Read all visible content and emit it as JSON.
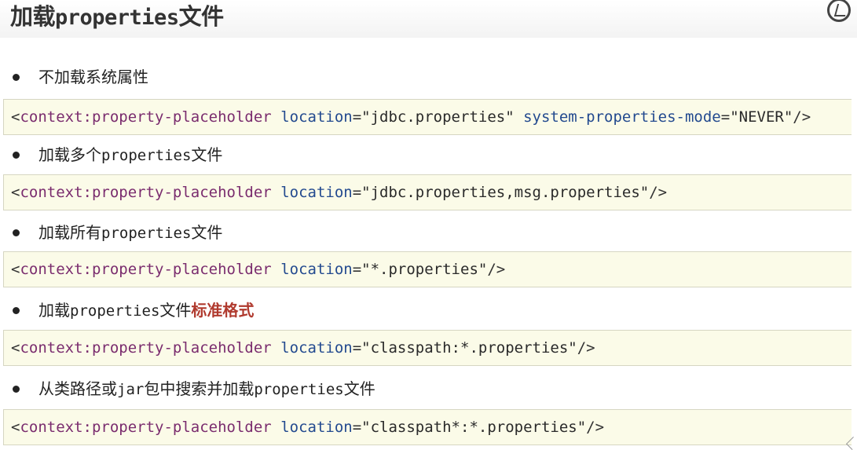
{
  "title": {
    "prefix": "加载",
    "mono": "properties",
    "suffix": "文件"
  },
  "corner_icon": "timer-icon",
  "sections": [
    {
      "bullet": {
        "pre": "不加载系统属性",
        "mono": "",
        "post": "",
        "emph": ""
      },
      "code": {
        "open": "<",
        "tag": "context:property-placeholder",
        "attr1": "location",
        "eq1": "=",
        "val1": "\"jdbc.properties\"",
        "attr2": "system-properties-mode",
        "eq2": "=",
        "val2": "\"NEVER\"",
        "close": "/>"
      }
    },
    {
      "bullet": {
        "pre": "加载多个",
        "mono": "properties",
        "post": "文件",
        "emph": ""
      },
      "code": {
        "open": "<",
        "tag": "context:property-placeholder",
        "attr1": "location",
        "eq1": "=",
        "val1": "\"jdbc.properties,msg.properties\"",
        "close": "/>"
      }
    },
    {
      "bullet": {
        "pre": "加载所有",
        "mono": "properties",
        "post": "文件",
        "emph": ""
      },
      "code": {
        "open": "<",
        "tag": "context:property-placeholder",
        "attr1": "location",
        "eq1": "=",
        "val1": "\"*.properties\"",
        "close": "/>"
      }
    },
    {
      "bullet": {
        "pre": "加载",
        "mono": "properties",
        "post": "文件",
        "emph": "标准格式"
      },
      "code": {
        "open": "<",
        "tag": "context:property-placeholder",
        "attr1": "location",
        "eq1": "=",
        "val1": "\"classpath:*.properties\"",
        "close": "/>"
      }
    },
    {
      "bullet": {
        "pre": "从类路径或",
        "mono": "jar",
        "post": "包中搜索并加载",
        "mono2": "properties",
        "post2": "文件"
      },
      "code": {
        "open": "<",
        "tag": "context:property-placeholder",
        "attr1": "location",
        "eq1": "=",
        "val1": "\"classpath*:*.properties\"",
        "close": "/>"
      }
    }
  ]
}
